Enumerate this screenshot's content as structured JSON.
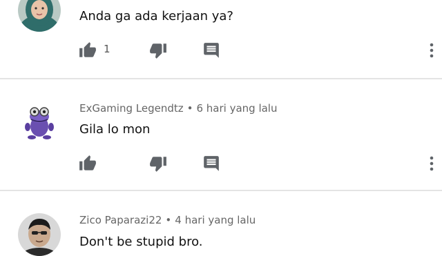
{
  "comments": [
    {
      "text": "Anda ga ada kerjaan ya?",
      "like_count": "1",
      "avatar_icon": "avatar-hijab-woman-icon"
    },
    {
      "author": "ExGaming Legendtz",
      "separator": "•",
      "time": "6 hari yang lalu",
      "text": "Gila lo mon",
      "avatar_icon": "avatar-purple-frog-icon"
    },
    {
      "author": "Zico Paparazi22",
      "separator": "•",
      "time": "4 hari yang lalu",
      "text": "Don't be stupid bro.",
      "avatar_icon": "avatar-man-photo-icon"
    }
  ],
  "icons": {
    "like": "thumb-up-icon",
    "dislike": "thumb-down-icon",
    "reply": "reply-comment-icon",
    "more": "more-vert-icon"
  },
  "colors": {
    "icon": "#5f6368",
    "meta_text": "#666666",
    "divider": "#e4e4e4"
  }
}
